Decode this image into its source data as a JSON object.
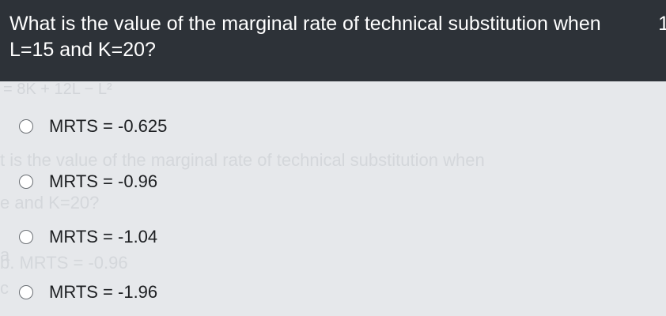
{
  "question": {
    "text": "What is the value of the marginal rate of technical substitution when L=15 and K=20?",
    "number": "1"
  },
  "watermark": {
    "formula": "= 8K + 12L − L²",
    "question_line1": "t is the value of the marginal rate of technical substitution when",
    "question_line2": "e and K=20?",
    "option_a": "a",
    "option_b": "b. MRTS = -0.96",
    "option_c": "c"
  },
  "options": [
    {
      "label": "MRTS = -0.625"
    },
    {
      "label": "MRTS = -0.96"
    },
    {
      "label": "MRTS = -1.04"
    },
    {
      "label": "MRTS = -1.96"
    }
  ]
}
